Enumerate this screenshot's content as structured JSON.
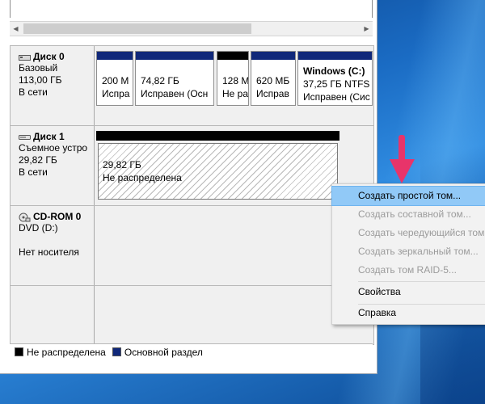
{
  "colors": {
    "primary_partition": "#10287a",
    "unallocated": "#000000",
    "menu_highlight": "#91c9f7",
    "pointer_arrow": "#e8346a"
  },
  "disks": [
    {
      "name": "Диск 0",
      "type": "Базовый",
      "size": "113,00 ГБ",
      "status": "В сети",
      "icon": "hard-disk-icon",
      "partitions": [
        {
          "line1": "200 М",
          "line2": "Испра"
        },
        {
          "line1": "74,82 ГБ",
          "line2": "Исправен (Осн"
        },
        {
          "line1": "128 М",
          "line2": "Не ра"
        },
        {
          "line1": "620 МБ",
          "line2": "Исправ"
        },
        {
          "title": "Windows (C:)",
          "line1": "37,25 ГБ NTFS",
          "line2": "Исправен (Сис"
        }
      ]
    },
    {
      "name": "Диск 1",
      "type": "Съемное устро",
      "size": "29,82 ГБ",
      "status": "В сети",
      "icon": "removable-disk-icon",
      "unallocated": {
        "size": "29,82 ГБ",
        "label": "Не распределена"
      }
    },
    {
      "name": "CD-ROM 0",
      "type": "DVD (D:)",
      "status": "Нет носителя",
      "icon": "cdrom-icon"
    }
  ],
  "context_menu": {
    "items": [
      {
        "label": "Создать простой том...",
        "enabled": true,
        "highlighted": true
      },
      {
        "label": "Создать составной том...",
        "enabled": false
      },
      {
        "label": "Создать чередующийся том...",
        "enabled": false
      },
      {
        "label": "Создать зеркальный том...",
        "enabled": false
      },
      {
        "label": "Создать том RAID-5...",
        "enabled": false
      },
      {
        "label": "Свойства",
        "enabled": true
      },
      {
        "label": "Справка",
        "enabled": true
      }
    ]
  },
  "legend": {
    "unallocated": "Не распределена",
    "primary": "Основной раздел"
  }
}
